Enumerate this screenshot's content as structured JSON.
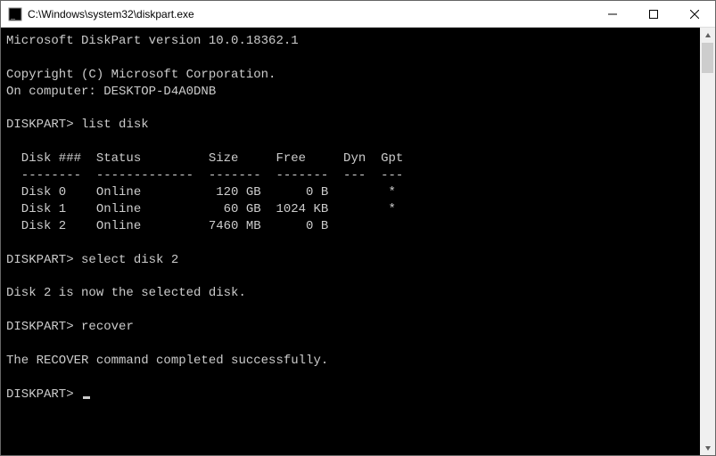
{
  "window": {
    "title": "C:\\Windows\\system32\\diskpart.exe"
  },
  "console": {
    "header_version": "Microsoft DiskPart version 10.0.18362.1",
    "copyright": "Copyright (C) Microsoft Corporation.",
    "on_computer": "On computer: DESKTOP-D4A0DNB",
    "prompt": "DISKPART>",
    "cmd_list": "list disk",
    "table_header": "  Disk ###  Status         Size     Free     Dyn  Gpt",
    "table_sep": "  --------  -------------  -------  -------  ---  ---",
    "disks": [
      {
        "id": "Disk 0",
        "status": "Online",
        "size": "120 GB",
        "free": "0 B",
        "dyn": "",
        "gpt": "*"
      },
      {
        "id": "Disk 1",
        "status": "Online",
        "size": "60 GB",
        "free": "1024 KB",
        "dyn": "",
        "gpt": "*"
      },
      {
        "id": "Disk 2",
        "status": "Online",
        "size": "7460 MB",
        "free": "0 B",
        "dyn": "",
        "gpt": ""
      }
    ],
    "row0": "  Disk 0    Online          120 GB      0 B        *",
    "row1": "  Disk 1    Online           60 GB  1024 KB        *",
    "row2": "  Disk 2    Online         7460 MB      0 B",
    "cmd_select": "select disk 2",
    "msg_selected": "Disk 2 is now the selected disk.",
    "cmd_recover": "recover",
    "msg_recover": "The RECOVER command completed successfully."
  }
}
